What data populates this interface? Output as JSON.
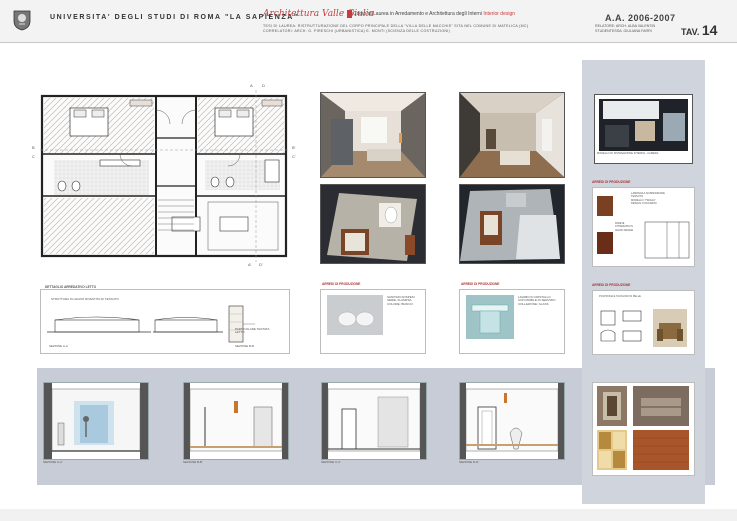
{
  "header": {
    "university": "UNIVERSITA' DEGLI STUDI DI ROMA \"LA SAPIENZA\"",
    "signature": "Architettura Valle Giulia",
    "course_prefix": "Corso di Laurea in Arredamento e Architettura degli Interni",
    "course_suffix": "Interior design",
    "thesis_line1": "TESI DI LAUREA: RISTRUTTURAZIONE DEL CORPO PRINCIPALE DELLA \"VILLA DELLE MACCHIE\" SITA NEL COMUNE DI MATELICA (MC)",
    "thesis_line2": "CORRELATORI: ARCH. G. PIRESCHI (URBANISTICA) E. MONTI (SCIENZA DELLE COSTRUZIONI)",
    "academic_year": "A.A. 2006-2007",
    "relatore": "RELATORE: ARCH. ALBA VALENTIN",
    "studentessa": "STUDENTESSA: GIULIANA FARRI",
    "tav_label": "TAV.",
    "tav_number": "14"
  },
  "plan": {
    "section_marks": [
      "A",
      "D",
      "B",
      "C"
    ],
    "bottom_marks": [
      "A'",
      "D'"
    ],
    "side_marks": [
      "B'",
      "C'"
    ]
  },
  "section_detail": {
    "title": "DETTAGLIO ARREDATIVO LETTO",
    "note": "STRUTTURA IN LEGNO RIVESTITA DI TESSUTO",
    "left_caption": "SEZIONE A-A",
    "right_caption": "SEZIONE B-B",
    "callout": "PARTICOLARE TESTATA LETTO"
  },
  "products": [
    {
      "title": "ARREDI DI PRODUZIONE",
      "lines": [
        "SANITARI SOSPESI",
        "SERIE: FLAMINIA",
        "COLORE: BIANCO"
      ]
    },
    {
      "title": "ARREDI DI PRODUZIONE",
      "lines": [
        "LAVABO IN CRISTALLO",
        "CON MOBILE DI SERVIZIO",
        "COLLEZIONE: GLASS"
      ]
    }
  ],
  "sidebar": {
    "photo_caption": "MODELLO DI SISTEMAZIONE INTERNA - CAMERA",
    "block1_title": "ARREDI DI PRODUZIONE",
    "block1_lines": [
      "LAMPADA A SOSPENSIONE",
      "TESSUTO",
      "MODELLO: TWIGGY",
      "DESIGN: FOSCARINI"
    ],
    "block1_note": "PARETE ATTREZZATA IN LEGNO WENGE",
    "block2_title": "ARREDI DI PRODUZIONE",
    "block2_note": "POLTRONA E TAVOLINO IN PELLE"
  },
  "elevations": [
    "SEZIONE A-A'",
    "SEZIONE B-B'",
    "SEZIONE C-C'",
    "SEZIONE D-D'"
  ],
  "colors": {
    "accent_red": "#c73b3b",
    "sidebar": "#d0d4dd",
    "band": "#c8ccd6",
    "wood": "#8a4a2a"
  }
}
